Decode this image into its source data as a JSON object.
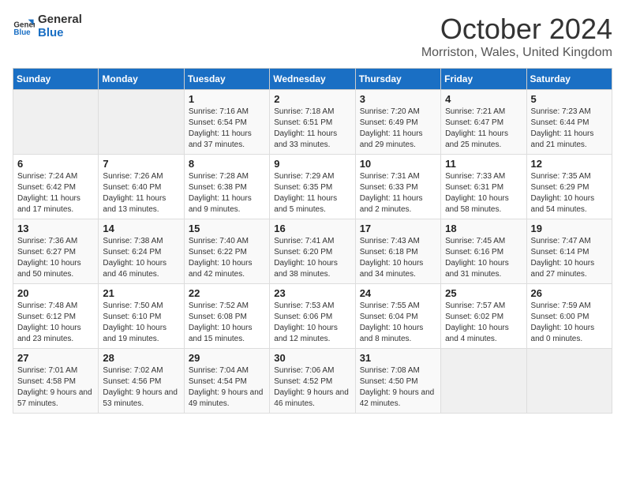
{
  "logo": {
    "line1": "General",
    "line2": "Blue"
  },
  "title": "October 2024",
  "location": "Morriston, Wales, United Kingdom",
  "days_of_week": [
    "Sunday",
    "Monday",
    "Tuesday",
    "Wednesday",
    "Thursday",
    "Friday",
    "Saturday"
  ],
  "weeks": [
    [
      {
        "day": "",
        "info": ""
      },
      {
        "day": "",
        "info": ""
      },
      {
        "day": "1",
        "info": "Sunrise: 7:16 AM\nSunset: 6:54 PM\nDaylight: 11 hours and 37 minutes."
      },
      {
        "day": "2",
        "info": "Sunrise: 7:18 AM\nSunset: 6:51 PM\nDaylight: 11 hours and 33 minutes."
      },
      {
        "day": "3",
        "info": "Sunrise: 7:20 AM\nSunset: 6:49 PM\nDaylight: 11 hours and 29 minutes."
      },
      {
        "day": "4",
        "info": "Sunrise: 7:21 AM\nSunset: 6:47 PM\nDaylight: 11 hours and 25 minutes."
      },
      {
        "day": "5",
        "info": "Sunrise: 7:23 AM\nSunset: 6:44 PM\nDaylight: 11 hours and 21 minutes."
      }
    ],
    [
      {
        "day": "6",
        "info": "Sunrise: 7:24 AM\nSunset: 6:42 PM\nDaylight: 11 hours and 17 minutes."
      },
      {
        "day": "7",
        "info": "Sunrise: 7:26 AM\nSunset: 6:40 PM\nDaylight: 11 hours and 13 minutes."
      },
      {
        "day": "8",
        "info": "Sunrise: 7:28 AM\nSunset: 6:38 PM\nDaylight: 11 hours and 9 minutes."
      },
      {
        "day": "9",
        "info": "Sunrise: 7:29 AM\nSunset: 6:35 PM\nDaylight: 11 hours and 5 minutes."
      },
      {
        "day": "10",
        "info": "Sunrise: 7:31 AM\nSunset: 6:33 PM\nDaylight: 11 hours and 2 minutes."
      },
      {
        "day": "11",
        "info": "Sunrise: 7:33 AM\nSunset: 6:31 PM\nDaylight: 10 hours and 58 minutes."
      },
      {
        "day": "12",
        "info": "Sunrise: 7:35 AM\nSunset: 6:29 PM\nDaylight: 10 hours and 54 minutes."
      }
    ],
    [
      {
        "day": "13",
        "info": "Sunrise: 7:36 AM\nSunset: 6:27 PM\nDaylight: 10 hours and 50 minutes."
      },
      {
        "day": "14",
        "info": "Sunrise: 7:38 AM\nSunset: 6:24 PM\nDaylight: 10 hours and 46 minutes."
      },
      {
        "day": "15",
        "info": "Sunrise: 7:40 AM\nSunset: 6:22 PM\nDaylight: 10 hours and 42 minutes."
      },
      {
        "day": "16",
        "info": "Sunrise: 7:41 AM\nSunset: 6:20 PM\nDaylight: 10 hours and 38 minutes."
      },
      {
        "day": "17",
        "info": "Sunrise: 7:43 AM\nSunset: 6:18 PM\nDaylight: 10 hours and 34 minutes."
      },
      {
        "day": "18",
        "info": "Sunrise: 7:45 AM\nSunset: 6:16 PM\nDaylight: 10 hours and 31 minutes."
      },
      {
        "day": "19",
        "info": "Sunrise: 7:47 AM\nSunset: 6:14 PM\nDaylight: 10 hours and 27 minutes."
      }
    ],
    [
      {
        "day": "20",
        "info": "Sunrise: 7:48 AM\nSunset: 6:12 PM\nDaylight: 10 hours and 23 minutes."
      },
      {
        "day": "21",
        "info": "Sunrise: 7:50 AM\nSunset: 6:10 PM\nDaylight: 10 hours and 19 minutes."
      },
      {
        "day": "22",
        "info": "Sunrise: 7:52 AM\nSunset: 6:08 PM\nDaylight: 10 hours and 15 minutes."
      },
      {
        "day": "23",
        "info": "Sunrise: 7:53 AM\nSunset: 6:06 PM\nDaylight: 10 hours and 12 minutes."
      },
      {
        "day": "24",
        "info": "Sunrise: 7:55 AM\nSunset: 6:04 PM\nDaylight: 10 hours and 8 minutes."
      },
      {
        "day": "25",
        "info": "Sunrise: 7:57 AM\nSunset: 6:02 PM\nDaylight: 10 hours and 4 minutes."
      },
      {
        "day": "26",
        "info": "Sunrise: 7:59 AM\nSunset: 6:00 PM\nDaylight: 10 hours and 0 minutes."
      }
    ],
    [
      {
        "day": "27",
        "info": "Sunrise: 7:01 AM\nSunset: 4:58 PM\nDaylight: 9 hours and 57 minutes."
      },
      {
        "day": "28",
        "info": "Sunrise: 7:02 AM\nSunset: 4:56 PM\nDaylight: 9 hours and 53 minutes."
      },
      {
        "day": "29",
        "info": "Sunrise: 7:04 AM\nSunset: 4:54 PM\nDaylight: 9 hours and 49 minutes."
      },
      {
        "day": "30",
        "info": "Sunrise: 7:06 AM\nSunset: 4:52 PM\nDaylight: 9 hours and 46 minutes."
      },
      {
        "day": "31",
        "info": "Sunrise: 7:08 AM\nSunset: 4:50 PM\nDaylight: 9 hours and 42 minutes."
      },
      {
        "day": "",
        "info": ""
      },
      {
        "day": "",
        "info": ""
      }
    ]
  ]
}
